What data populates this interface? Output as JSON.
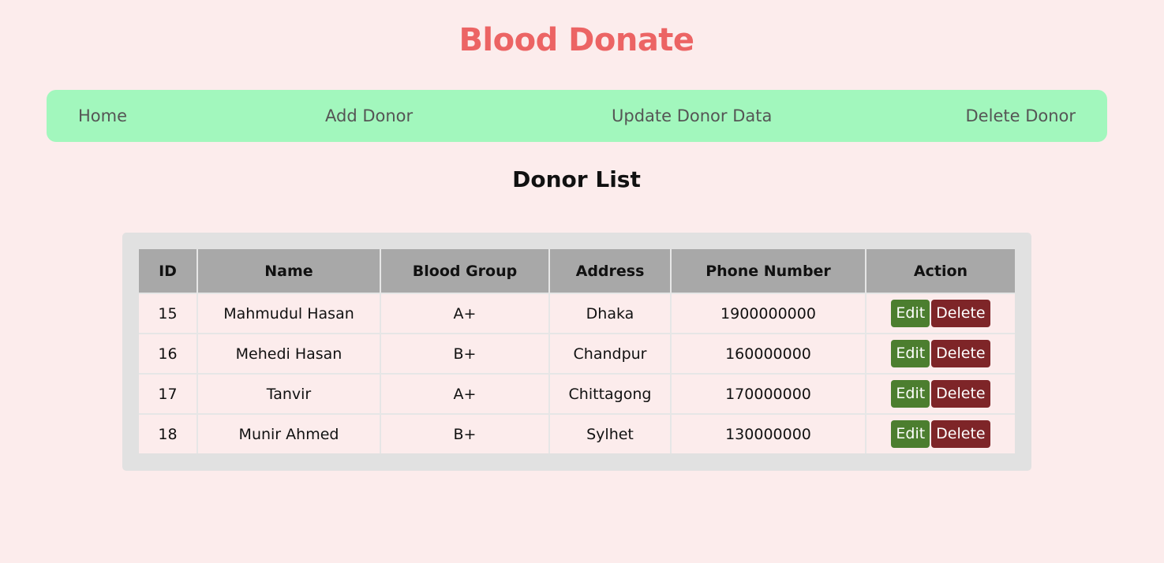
{
  "header": {
    "title": "Blood Donate"
  },
  "nav": {
    "items": [
      {
        "label": "Home"
      },
      {
        "label": "Add Donor"
      },
      {
        "label": "Update Donor Data"
      },
      {
        "label": "Delete Donor"
      }
    ]
  },
  "main": {
    "title": "Donor List",
    "table": {
      "headers": [
        "ID",
        "Name",
        "Blood Group",
        "Address",
        "Phone Number",
        "Action"
      ],
      "rows": [
        {
          "id": "15",
          "name": "Mahmudul Hasan",
          "blood_group": "A+",
          "address": "Dhaka",
          "phone": "1900000000"
        },
        {
          "id": "16",
          "name": "Mehedi Hasan",
          "blood_group": "B+",
          "address": "Chandpur",
          "phone": "160000000"
        },
        {
          "id": "17",
          "name": "Tanvir",
          "blood_group": "A+",
          "address": "Chittagong",
          "phone": "170000000"
        },
        {
          "id": "18",
          "name": "Munir Ahmed",
          "blood_group": "B+",
          "address": "Sylhet",
          "phone": "130000000"
        }
      ],
      "actions": {
        "edit_label": "Edit",
        "delete_label": "Delete"
      }
    }
  },
  "colors": {
    "page_background": "#fcecec",
    "title": "#ec6464",
    "nav_background": "#a2f7bd",
    "edit_button": "#4c7e2f",
    "delete_button": "#7e2528",
    "table_header": "#a8a8a8"
  }
}
